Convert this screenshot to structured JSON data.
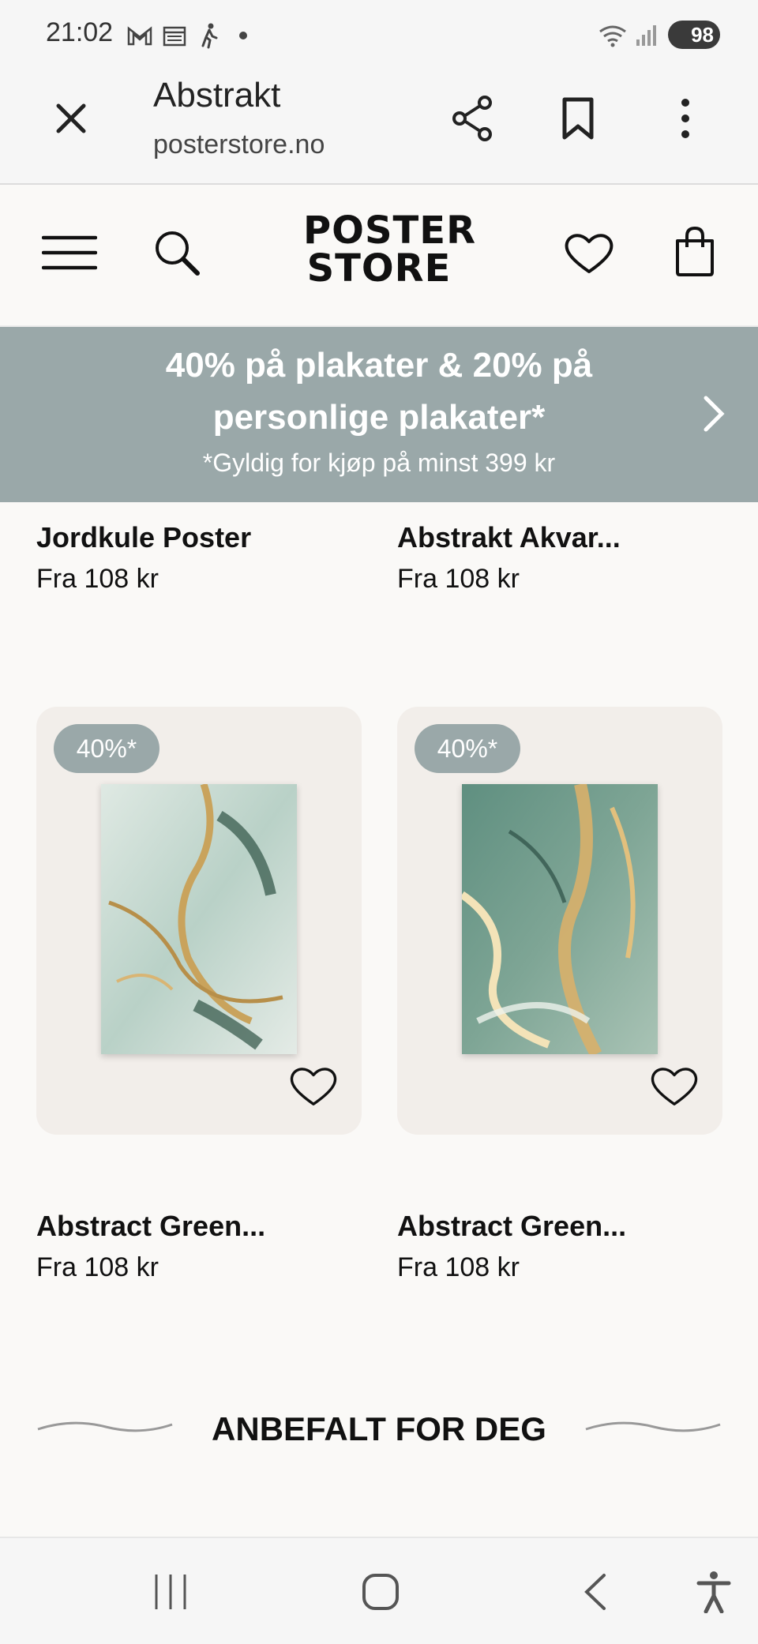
{
  "status_bar": {
    "time": "21:02",
    "battery": "98",
    "icons": [
      "gmail-icon",
      "calendar-icon",
      "walking-icon",
      "dot-icon",
      "wifi-icon",
      "signal-icon",
      "battery-icon"
    ]
  },
  "browser": {
    "title": "Abstrakt",
    "url": "posterstore.no",
    "actions": [
      "close-icon",
      "share-icon",
      "bookmark-icon",
      "more-vert-icon"
    ]
  },
  "header": {
    "logo_line1": "POSTER",
    "logo_line2": "STORE",
    "icons": [
      "menu-icon",
      "search-icon",
      "heart-icon",
      "shopping-bag-icon"
    ]
  },
  "promo": {
    "line1": "40% på plakater & 20% på",
    "line2": "personlige plakater*",
    "subtext": "*Gyldig for kjøp på minst 399 kr"
  },
  "products_top": [
    {
      "name": "Jordkule Poster",
      "price": "Fra 108 kr"
    },
    {
      "name": "Abstrakt Akvar...",
      "price": "Fra 108 kr"
    }
  ],
  "products": [
    {
      "badge": "40%*",
      "name": "Abstract Green...",
      "price": "Fra 108 kr"
    },
    {
      "badge": "40%*",
      "name": "Abstract Green...",
      "price": "Fra 108 kr"
    }
  ],
  "section_title": "ANBEFALT FOR DEG",
  "colors": {
    "promo_bg": "#9aa8a9",
    "card_bg": "#f2eeea",
    "page_bg": "#faf9f7"
  }
}
